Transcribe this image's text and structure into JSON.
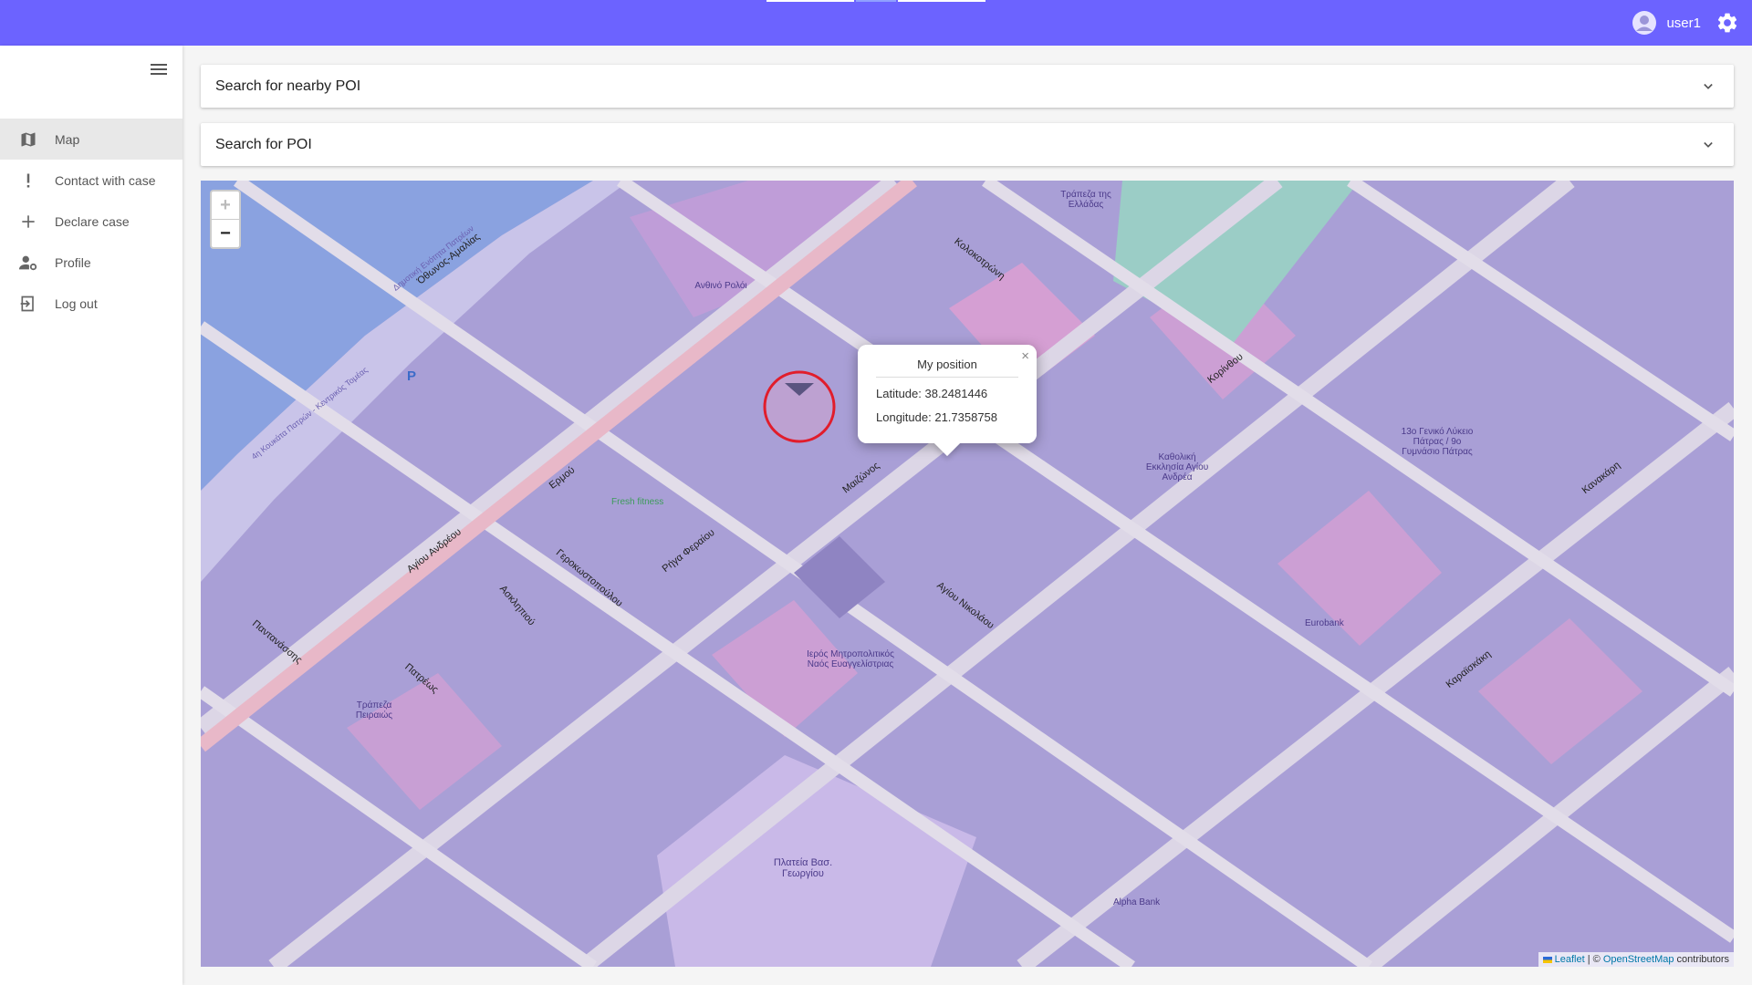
{
  "topbar": {
    "username": "user1"
  },
  "sidebar": {
    "items": [
      {
        "label": "Map",
        "icon": "map-icon",
        "active": true
      },
      {
        "label": "Contact with case",
        "icon": "exclamation-icon",
        "active": false
      },
      {
        "label": "Declare case",
        "icon": "plus-icon",
        "active": false
      },
      {
        "label": "Profile",
        "icon": "user-settings-icon",
        "active": false
      },
      {
        "label": "Log out",
        "icon": "logout-icon",
        "active": false
      }
    ]
  },
  "accordions": {
    "nearby": "Search for nearby POI",
    "poi": "Search for POI"
  },
  "map": {
    "zoom_in": "+",
    "zoom_out": "−",
    "popup": {
      "title": "My position",
      "latitude": "Latitude: 38.2481446",
      "longitude": "Longitude: 21.7358758",
      "close": "×"
    },
    "attribution": {
      "leaflet": "Leaflet",
      "sep": " | © ",
      "osm": "OpenStreetMap",
      "suffix": " contributors"
    },
    "labels": {
      "church": "Ιερός Μητροπολιτικός Ναός Ευαγγελίστριας",
      "square": "Πλατεία Βασ. Γεωργίου",
      "agios_andreas": "Καθολική Εκκλησία Αγίου Ανδρέα",
      "lykeio": "13ο Γενικό Λύκειο Πάτρας / 9ο Γυμνάσιο Πάτρας",
      "st_ermou": "Ερμού",
      "st_maizonos": "Μαιζώνος",
      "st_korinthou": "Κορίνθου",
      "st_agiou_nikolaou": "Αγίου Νικολάου",
      "st_kolokotroni": "Κολοκοτρώνη",
      "st_agiou_andreou": "Αγίου Ανδρέου",
      "st_othonos": "Όθωνος-Αμαλίας",
      "st_gerokostopoulou": "Γεροκωστοπούλου",
      "st_riga": "Ρήγα Φεραίου",
      "st_kanakari": "Κανακάρη",
      "st_karaiskaki": "Καραϊσκάκη",
      "st_patreos": "Πατρέως",
      "st_asklipiou": "Ασκληπιού",
      "st_pantanassis": "Παντανάσσης",
      "coastal": "4η Κουκάτα Πατρών - Κεντρικός Τομέας",
      "coastal2": "Δημοτική Ενότητα Πατρέων",
      "clock": "Ανθινό Ρολόι",
      "fresh": "Fresh fitness",
      "bank": "Τράπεζα Πειραιώς",
      "bank2": "Τράπεζα της Ελλάδας",
      "eurobank": "Eurobank",
      "alpha": "Alpha Bank",
      "parking": "P"
    }
  },
  "colors": {
    "topbar": "#6c63ff",
    "map_base": "#a99fd6",
    "road": "#d9d3e3",
    "water": "#8aa2e0",
    "park": "#9bcdc6",
    "pink": "#d59fd3",
    "marker": "#e11d2b"
  }
}
